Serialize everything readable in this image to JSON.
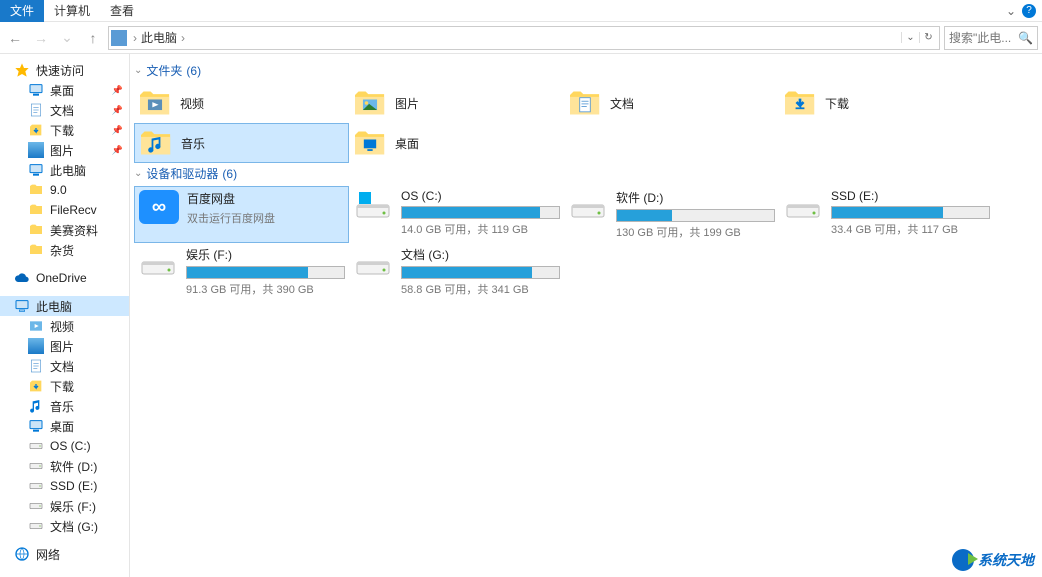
{
  "menubar": {
    "file": "文件",
    "computer": "计算机",
    "view": "查看",
    "help": "?"
  },
  "navbar": {
    "location_label": "此电脑",
    "search_placeholder": "搜索\"此电...",
    "back": "←",
    "forward": "→",
    "up": "↑",
    "chev": "›",
    "dropdown": "⌄",
    "refresh": "↻"
  },
  "sidebar": {
    "quick_access": "快速访问",
    "pinned": [
      {
        "name": "桌面",
        "icon": "monitor"
      },
      {
        "name": "文档",
        "icon": "doc"
      },
      {
        "name": "下载",
        "icon": "download"
      },
      {
        "name": "图片",
        "icon": "picture"
      }
    ],
    "unpinned_top": [
      {
        "name": "此电脑",
        "icon": "monitor"
      },
      {
        "name": "9.0",
        "icon": "folder"
      },
      {
        "name": "FileRecv",
        "icon": "folder"
      },
      {
        "name": "美赛资料",
        "icon": "folder"
      },
      {
        "name": "杂货",
        "icon": "folder"
      }
    ],
    "onedrive": "OneDrive",
    "this_pc": "此电脑",
    "this_pc_children": [
      {
        "name": "视频",
        "icon": "video"
      },
      {
        "name": "图片",
        "icon": "picture"
      },
      {
        "name": "文档",
        "icon": "doc"
      },
      {
        "name": "下载",
        "icon": "download"
      },
      {
        "name": "音乐",
        "icon": "music"
      },
      {
        "name": "桌面",
        "icon": "monitor"
      },
      {
        "name": "OS (C:)",
        "icon": "disk"
      },
      {
        "name": "软件 (D:)",
        "icon": "disk"
      },
      {
        "name": "SSD (E:)",
        "icon": "disk"
      },
      {
        "name": "娱乐 (F:)",
        "icon": "disk"
      },
      {
        "name": "文档 (G:)",
        "icon": "disk"
      }
    ],
    "network": "网络"
  },
  "content": {
    "folders_header": "文件夹",
    "folders_count": "(6)",
    "folders": [
      {
        "name": "视频",
        "icon": "video"
      },
      {
        "name": "图片",
        "icon": "picture"
      },
      {
        "name": "文档",
        "icon": "doc"
      },
      {
        "name": "下载",
        "icon": "download"
      },
      {
        "name": "音乐",
        "icon": "music",
        "selected": true
      },
      {
        "name": "桌面",
        "icon": "desktop"
      }
    ],
    "devices_header": "设备和驱动器",
    "devices_count": "(6)",
    "baidu": {
      "name": "百度网盘",
      "sub": "双击运行百度网盘",
      "selected": true
    },
    "drives": [
      {
        "name": "OS (C:)",
        "free": "14.0 GB 可用，共 119 GB",
        "fill_pct": 88,
        "icon": "os"
      },
      {
        "name": "软件 (D:)",
        "free": "130 GB 可用，共 199 GB",
        "fill_pct": 35
      },
      {
        "name": "SSD (E:)",
        "free": "33.4 GB 可用，共 117 GB",
        "fill_pct": 71
      },
      {
        "name": "娱乐 (F:)",
        "free": "91.3 GB 可用，共 390 GB",
        "fill_pct": 77
      },
      {
        "name": "文档 (G:)",
        "free": "58.8 GB 可用，共 341 GB",
        "fill_pct": 83
      }
    ]
  },
  "watermark": "系统天地"
}
